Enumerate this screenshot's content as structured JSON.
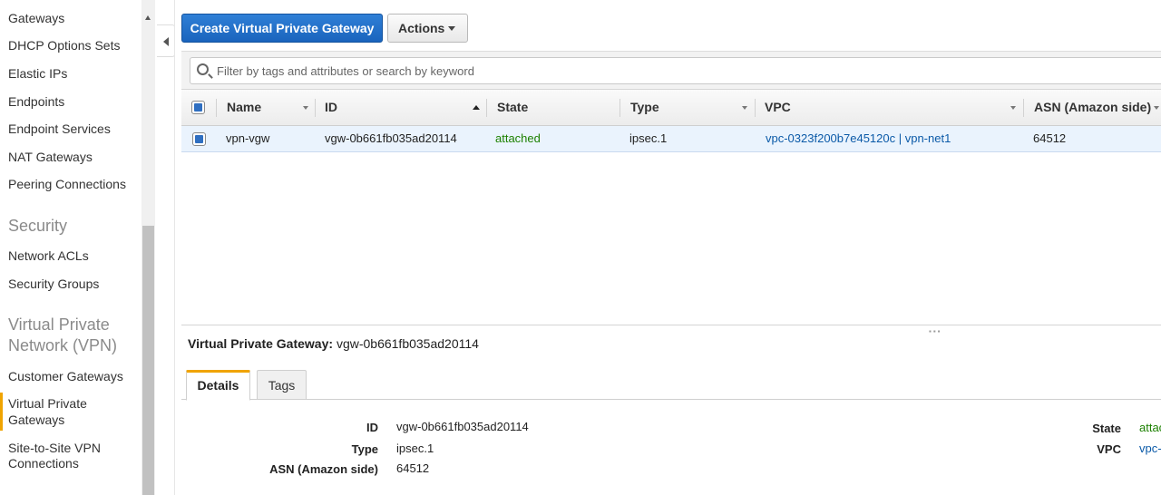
{
  "sidebar": {
    "items": [
      {
        "label": "Gateways"
      },
      {
        "label": "DHCP Options Sets"
      },
      {
        "label": "Elastic IPs"
      },
      {
        "label": "Endpoints"
      },
      {
        "label": "Endpoint Services"
      },
      {
        "label": "NAT Gateways"
      },
      {
        "label": "Peering Connections"
      }
    ],
    "security_heading": "Security",
    "security_items": [
      {
        "label": "Network ACLs"
      },
      {
        "label": "Security Groups"
      }
    ],
    "vpn_heading_line1": "Virtual Private",
    "vpn_heading_line2": "Network (VPN)",
    "vpn_items": [
      {
        "label": "Customer Gateways"
      },
      {
        "label_line1": "Virtual Private",
        "label_line2": "Gateways",
        "active": true
      },
      {
        "label_line1": "Site-to-Site VPN",
        "label_line2": "Connections"
      }
    ]
  },
  "toolbar": {
    "create_label": "Create Virtual Private Gateway",
    "actions_label": "Actions"
  },
  "filter": {
    "placeholder": "Filter by tags and attributes or search by keyword"
  },
  "table": {
    "columns": [
      "Name",
      "ID",
      "State",
      "Type",
      "VPC",
      "ASN (Amazon side)"
    ],
    "rows": [
      {
        "name": "vpn-vgw",
        "id": "vgw-0b661fb035ad20114",
        "state": "attached",
        "type": "ipsec.1",
        "vpc": "vpc-0323f200b7e45120c | vpn-net1",
        "asn": "64512"
      }
    ]
  },
  "detail": {
    "title_label": "Virtual Private Gateway:",
    "title_value": "vgw-0b661fb035ad20114",
    "tabs": [
      "Details",
      "Tags"
    ],
    "fields_left": [
      {
        "label": "ID",
        "value": "vgw-0b661fb035ad20114"
      },
      {
        "label": "Type",
        "value": "ipsec.1"
      },
      {
        "label": "ASN (Amazon side)",
        "value": "64512"
      }
    ],
    "fields_right": [
      {
        "label": "State",
        "value": "attac"
      },
      {
        "label": "VPC",
        "value": "vpc-"
      }
    ]
  },
  "colors": {
    "primary": "#1a64bd",
    "active_accent": "#f0a400",
    "state_green": "#1d8102",
    "link_blue": "#0b5aa8"
  }
}
